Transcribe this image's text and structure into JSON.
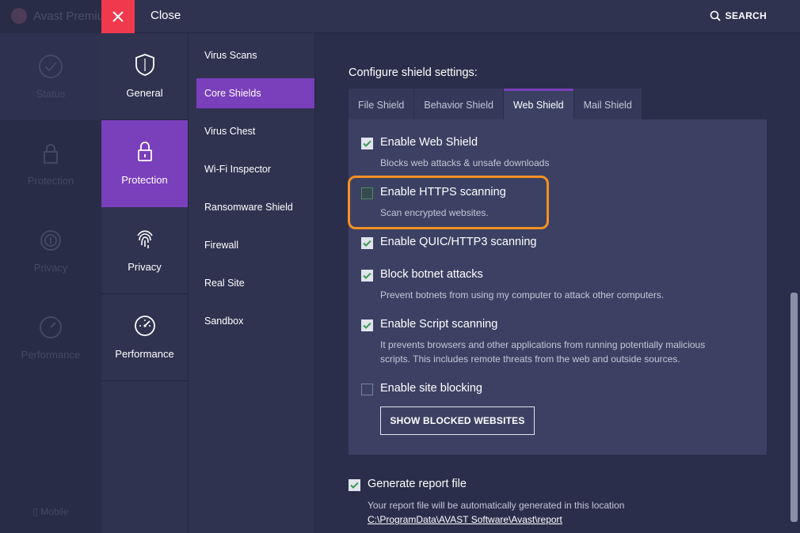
{
  "base": {
    "brand": "Avast Premiu",
    "items": [
      "Status",
      "Protection",
      "Privacy",
      "Performance"
    ],
    "mobile": "Mobile"
  },
  "topbar": {
    "close_label": "Close",
    "search_label": "SEARCH"
  },
  "categories": [
    "General",
    "Protection",
    "Privacy",
    "Performance"
  ],
  "active_category": "Protection",
  "subnav": [
    "Virus Scans",
    "Core Shields",
    "Virus Chest",
    "Wi-Fi Inspector",
    "Ransomware Shield",
    "Firewall",
    "Real Site",
    "Sandbox"
  ],
  "active_subnav": "Core Shields",
  "content": {
    "title": "Configure shield settings:",
    "tabs": [
      "File Shield",
      "Behavior Shield",
      "Web Shield",
      "Mail Shield"
    ],
    "active_tab": "Web Shield",
    "options": [
      {
        "title": "Enable Web Shield",
        "desc": "Blocks web attacks & unsafe downloads",
        "checked": true
      },
      {
        "title": "Enable HTTPS scanning",
        "desc": "Scan encrypted websites.",
        "checked": false
      },
      {
        "title": "Enable QUIC/HTTP3 scanning",
        "desc": "",
        "checked": true
      },
      {
        "title": "Block botnet attacks",
        "desc": "Prevent botnets from using my computer to attack other computers.",
        "checked": true
      },
      {
        "title": "Enable Script scanning",
        "desc": "It prevents browsers and other applications from running potentially malicious scripts. This includes remote threats from the web and outside sources.",
        "checked": true
      },
      {
        "title": "Enable site blocking",
        "desc": "",
        "checked": false
      }
    ],
    "blocked_button": "SHOW BLOCKED WEBSITES",
    "report": {
      "title": "Generate report file",
      "desc": "Your report file will be automatically generated in this location",
      "path": "C:\\ProgramData\\AVAST Software\\Avast\\report",
      "checked": true
    }
  },
  "colors": {
    "accent": "#7a3fbb",
    "close": "#f0394d",
    "highlight": "#f59123",
    "check": "#3b9a52"
  }
}
